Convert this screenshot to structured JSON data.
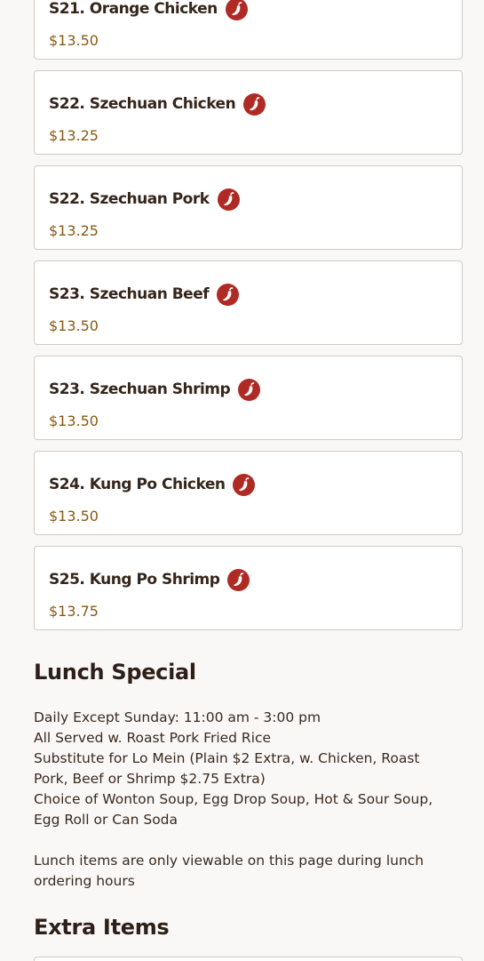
{
  "menu_items": [
    {
      "name": "S21. Orange Chicken",
      "price": "$13.50",
      "icon": "spicy-pepper-icon"
    },
    {
      "name": "S22. Szechuan Chicken",
      "price": "$13.25",
      "icon": "spicy-pepper-icon"
    },
    {
      "name": "S22. Szechuan Pork",
      "price": "$13.25",
      "icon": "spicy-pepper-icon"
    },
    {
      "name": "S23. Szechuan Beef",
      "price": "$13.50",
      "icon": "spicy-pepper-icon"
    },
    {
      "name": "S23. Szechuan Shrimp",
      "price": "$13.50",
      "icon": "spicy-pepper-icon"
    },
    {
      "name": "S24. Kung Po Chicken",
      "price": "$13.50",
      "icon": "spicy-pepper-icon"
    },
    {
      "name": "S25. Kung Po Shrimp",
      "price": "$13.75",
      "icon": "spicy-pepper-icon"
    }
  ],
  "lunch_special": {
    "title": "Lunch Special",
    "lines": [
      "Daily Except Sunday: 11:00 am - 3:00 pm",
      "All Served w. Roast Pork Fried Rice",
      "Substitute for Lo Mein (Plain $2 Extra, w. Chicken, Roast Pork, Beef or Shrimp $2.75 Extra)",
      "Choice of Wonton Soup, Egg Drop Soup, Hot & Sour Soup, Egg Roll or Can Soda"
    ],
    "note": "Lunch items are only viewable on this page during lunch ordering hours"
  },
  "extra_items": {
    "title": "Extra Items"
  },
  "colors": {
    "background": "#faf8f7",
    "card": "#ffffff",
    "border": "#cfcac6",
    "price": "#8a5a14",
    "spicy": "#b02a25"
  }
}
